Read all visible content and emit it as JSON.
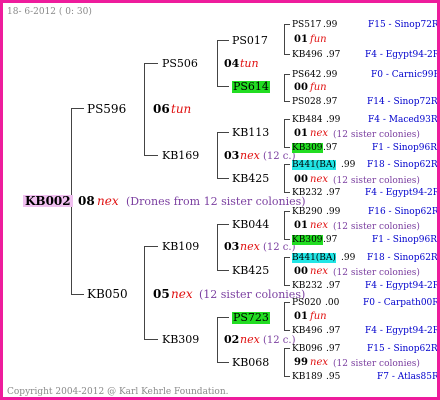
{
  "header_date": "18- 6-2012 ( 0: 30)",
  "copyright": "Copyright 2004-2012 @ Karl Kehrle Foundation.",
  "root": {
    "id": "KB002",
    "year": "08",
    "race": "nex",
    "note": "(Drones from 12 sister colonies)"
  },
  "gen1": [
    {
      "id": "PS596",
      "year": "06",
      "race": "tun",
      "note": ""
    },
    {
      "id": "KB050",
      "year": "05",
      "race": "nex",
      "note": "(12 sister colonies)"
    }
  ],
  "gen2": [
    {
      "id": "PS506",
      "year": "04",
      "race": "tun",
      "note": ""
    },
    {
      "id": "KB169",
      "year": "03",
      "race": "nex",
      "note": "(12 c.)"
    },
    {
      "id": "KB109",
      "year": "03",
      "race": "nex",
      "note": "(12 c.)"
    },
    {
      "id": "KB309",
      "year": "02",
      "race": "nex",
      "note": "(12 c.)"
    }
  ],
  "gen3": [
    {
      "id": "PS017",
      "year": "",
      "race": "",
      "note": ""
    },
    {
      "id": "PS614",
      "year": "",
      "race": "",
      "note": ""
    },
    {
      "id": "KB113",
      "year": "",
      "race": "",
      "note": ""
    },
    {
      "id": "KB425",
      "year": "",
      "race": "",
      "note": ""
    },
    {
      "id": "KB044",
      "year": "",
      "race": "",
      "note": ""
    },
    {
      "id": "KB425",
      "year": "",
      "race": "",
      "note": ""
    },
    {
      "id": "PS723",
      "year": "",
      "race": "",
      "note": ""
    },
    {
      "id": "KB068",
      "year": "",
      "race": "",
      "note": ""
    }
  ],
  "gen4": [
    {
      "id": "PS517",
      "val": ".99",
      "origin": "F15 - Sinop72R"
    },
    {
      "year": "01",
      "race": "fun",
      "note": ""
    },
    {
      "id": "KB496",
      "val": ".97",
      "origin": "F4 - Egypt94-2R"
    },
    {
      "id": "PS642",
      "val": ".99",
      "origin": "F0 - Carnic99R"
    },
    {
      "year": "00",
      "race": "fun",
      "note": ""
    },
    {
      "id": "PS028",
      "val": ".97",
      "origin": "F14 - Sinop72R"
    },
    {
      "id": "KB484",
      "val": ".99",
      "origin": "F4 - Maced93R"
    },
    {
      "year": "01",
      "race": "nex",
      "note": "(12 sister colonies)"
    },
    {
      "id": "KB309",
      "val": ".97",
      "origin": "F1 - Sinop96R"
    },
    {
      "id": "B441(BA)",
      "val": ".99",
      "origin": "F18 - Sinop62R"
    },
    {
      "year": "00",
      "race": "nex",
      "note": "(12 sister colonies)"
    },
    {
      "id": "KB232",
      "val": ".97",
      "origin": "F4 - Egypt94-2R"
    },
    {
      "id": "KB290",
      "val": ".99",
      "origin": "F16 - Sinop62R"
    },
    {
      "year": "01",
      "race": "nex",
      "note": "(12 sister colonies)"
    },
    {
      "id": "KB309",
      "val": ".97",
      "origin": "F1 - Sinop96R"
    },
    {
      "id": "B441(BA)",
      "val": ".99",
      "origin": "F18 - Sinop62R"
    },
    {
      "year": "00",
      "race": "nex",
      "note": "(12 sister colonies)"
    },
    {
      "id": "KB232",
      "val": ".97",
      "origin": "F4 - Egypt94-2R"
    },
    {
      "id": "PS020",
      "val": ".00",
      "origin": "F0 - Carpath00R"
    },
    {
      "year": "01",
      "race": "fun",
      "note": ""
    },
    {
      "id": "KB496",
      "val": ".97",
      "origin": "F4 - Egypt94-2R"
    },
    {
      "id": "KB096",
      "val": ".97",
      "origin": "F15 - Sinop62R"
    },
    {
      "year": "99",
      "race": "nex",
      "note": "(12 sister colonies)"
    },
    {
      "id": "KB189",
      "val": ".95",
      "origin": "F7 - Atlas85R"
    }
  ]
}
